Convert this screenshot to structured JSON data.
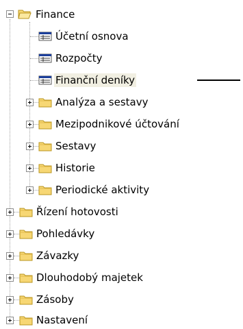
{
  "tree": {
    "root": {
      "label": "Finance",
      "icon": "folder-open-icon",
      "children": [
        {
          "label": "Účetní osnova",
          "icon": "table-icon"
        },
        {
          "label": "Rozpočty",
          "icon": "table-icon"
        },
        {
          "label": "Finanční deníky",
          "icon": "table-icon",
          "selected": true
        },
        {
          "label": "Analýza a sestavy",
          "icon": "folder-icon"
        },
        {
          "label": "Mezipodnikové účtování",
          "icon": "folder-icon"
        },
        {
          "label": "Sestavy",
          "icon": "folder-icon"
        },
        {
          "label": "Historie",
          "icon": "folder-icon"
        },
        {
          "label": "Periodické aktivity",
          "icon": "folder-icon"
        }
      ]
    },
    "siblings": [
      {
        "label": "Řízení hotovosti",
        "icon": "folder-icon"
      },
      {
        "label": "Pohledávky",
        "icon": "folder-icon"
      },
      {
        "label": "Závazky",
        "icon": "folder-icon"
      },
      {
        "label": "Dlouhodobý majetek",
        "icon": "folder-icon"
      },
      {
        "label": "Zásoby",
        "icon": "folder-icon"
      },
      {
        "label": "Nastavení",
        "icon": "folder-icon"
      }
    ]
  },
  "colors": {
    "folder_fill": "#f7d774",
    "folder_stroke": "#b8941f",
    "selected_bg": "#f1efe2"
  }
}
